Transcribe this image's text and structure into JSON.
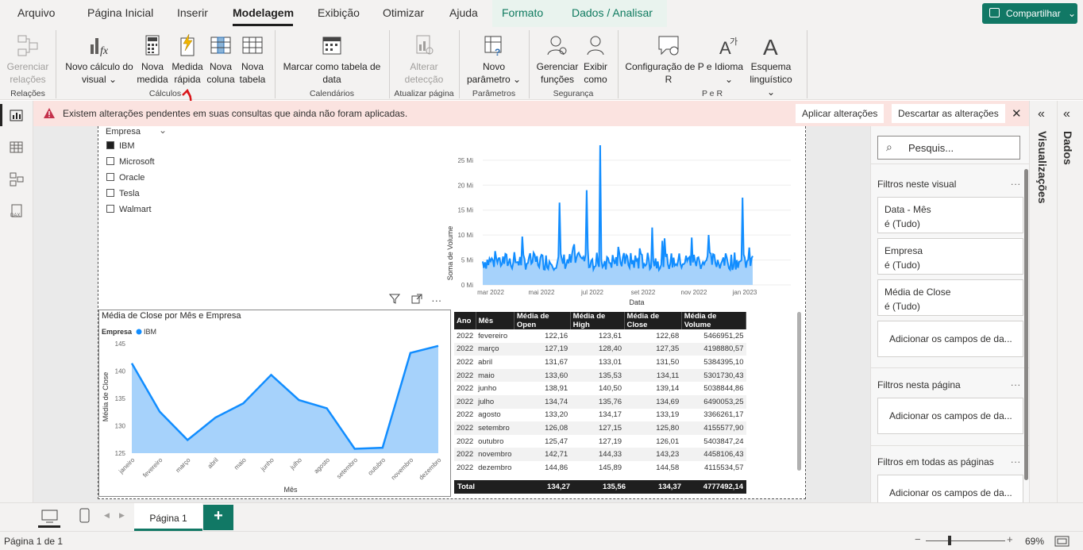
{
  "menu": {
    "items": [
      "Arquivo",
      "Página Inicial",
      "Inserir",
      "Modelagem",
      "Exibição",
      "Otimizar",
      "Ajuda",
      "Formato",
      "Dados / Analisar"
    ],
    "share_label": "Compartilhar"
  },
  "ribbon": {
    "buttons": [
      {
        "label": "Gerenciar relações",
        "icon": "relationships-icon",
        "disabled": true
      },
      {
        "label": "Novo cálculo do visual",
        "icon": "visual-calculation-icon"
      },
      {
        "label": "Nova medida",
        "icon": "calculator-icon"
      },
      {
        "label": "Medida rápida",
        "icon": "quick-measure-icon"
      },
      {
        "label": "Nova coluna",
        "icon": "new-column-icon"
      },
      {
        "label": "Nova tabela",
        "icon": "new-table-icon"
      },
      {
        "label": "Marcar como tabela de data",
        "icon": "calendar-icon"
      },
      {
        "label": "Alterar detecção",
        "icon": "change-detection-icon",
        "disabled": true
      },
      {
        "label": "Novo parâmetro",
        "icon": "parameter-icon"
      },
      {
        "label": "Gerenciar funções",
        "icon": "manage-roles-icon"
      },
      {
        "label": "Exibir como",
        "icon": "view-as-icon"
      },
      {
        "label": "Configuração de P e R",
        "icon": "qa-setup-icon"
      },
      {
        "label": "Idioma",
        "icon": "language-icon"
      },
      {
        "label": "Esquema linguístico",
        "icon": "linguistic-schema-icon"
      }
    ],
    "groups": [
      "Relações",
      "Cálculos",
      "Calendários",
      "Atualizar página",
      "Parâmetros",
      "Segurança",
      "P e R"
    ]
  },
  "warning": {
    "text": "Existem alterações pendentes em suas consultas que ainda não foram aplicadas.",
    "apply_label": "Aplicar alterações",
    "discard_label": "Descartar as alterações"
  },
  "slicer": {
    "title": "Empresa",
    "items": [
      {
        "label": "IBM",
        "checked": true
      },
      {
        "label": "Microsoft",
        "checked": false
      },
      {
        "label": "Oracle",
        "checked": false
      },
      {
        "label": "Tesla",
        "checked": false
      },
      {
        "label": "Walmart",
        "checked": false
      }
    ]
  },
  "volume_chart": {
    "ylabel": "Soma de Volume",
    "xlabel": "Data",
    "yticks": [
      "0 Mi",
      "5 Mi",
      "10 Mi",
      "15 Mi",
      "20 Mi",
      "25 Mi"
    ],
    "xticks": [
      "mar 2022",
      "mai 2022",
      "jul 2022",
      "set 2022",
      "nov 2022",
      "jan 2023"
    ]
  },
  "close_chart": {
    "title": "Média de Close por Mês e Empresa",
    "legend_title": "Empresa",
    "legend_item": "IBM",
    "ylabel": "Média de Close",
    "xlabel": "Mês",
    "yticks": [
      "125",
      "130",
      "135",
      "140",
      "145"
    ]
  },
  "chart_data": [
    {
      "type": "area",
      "title": "",
      "xlabel": "Data",
      "ylabel": "Soma de Volume",
      "ylim": [
        0,
        28000000
      ],
      "x": [
        "mar 2022",
        "mai 2022",
        "jul 2022",
        "set 2022",
        "nov 2022",
        "jan 2023"
      ],
      "series": [
        {
          "values": [
            4500000,
            4000000,
            5000000,
            5500000,
            4200000,
            5300000
          ]
        }
      ],
      "notes_peak": 28000000
    },
    {
      "type": "area",
      "title": "Média de Close por Mês e Empresa",
      "xlabel": "Mês",
      "ylabel": "Média de Close",
      "ylim": [
        125,
        145
      ],
      "categories": [
        "janeiro",
        "fevereiro",
        "março",
        "abril",
        "maio",
        "junho",
        "julho",
        "agosto",
        "setembro",
        "outubro",
        "novembro",
        "dezembro"
      ],
      "series": [
        {
          "name": "IBM",
          "values": [
            141.4,
            132.6,
            127.4,
            131.5,
            134.1,
            139.3,
            134.7,
            133.2,
            125.8,
            126.0,
            143.3,
            144.6
          ]
        }
      ],
      "legend": "top-left"
    }
  ],
  "table": {
    "headers": [
      "Ano",
      "Mês",
      "Média de Open",
      "Média de High",
      "Média de Close",
      "Média de Volume"
    ],
    "rows": [
      [
        "2022",
        "fevereiro",
        "122,16",
        "123,61",
        "122,68",
        "5466951,25"
      ],
      [
        "2022",
        "março",
        "127,19",
        "128,40",
        "127,35",
        "4198880,57"
      ],
      [
        "2022",
        "abril",
        "131,67",
        "133,01",
        "131,50",
        "5384395,10"
      ],
      [
        "2022",
        "maio",
        "133,60",
        "135,53",
        "134,11",
        "5301730,43"
      ],
      [
        "2022",
        "junho",
        "138,91",
        "140,50",
        "139,14",
        "5038844,86"
      ],
      [
        "2022",
        "julho",
        "134,74",
        "135,76",
        "134,69",
        "6490053,25"
      ],
      [
        "2022",
        "agosto",
        "133,20",
        "134,17",
        "133,19",
        "3366261,17"
      ],
      [
        "2022",
        "setembro",
        "126,08",
        "127,15",
        "125,80",
        "4155577,90"
      ],
      [
        "2022",
        "outubro",
        "125,47",
        "127,19",
        "126,01",
        "5403847,24"
      ],
      [
        "2022",
        "novembro",
        "142,71",
        "144,33",
        "143,23",
        "4458106,43"
      ],
      [
        "2022",
        "dezembro",
        "144,86",
        "145,89",
        "144,58",
        "4115534,57"
      ]
    ],
    "total": [
      "Total",
      "134,27",
      "135,56",
      "134,37",
      "4777492,14"
    ]
  },
  "filters": {
    "search_placeholder": "Pesquis...",
    "visual_header": "Filtros neste visual",
    "visual_cards": [
      {
        "name": "Data - Mês",
        "state": "é (Tudo)"
      },
      {
        "name": "Empresa",
        "state": "é (Tudo)"
      },
      {
        "name": "Média de Close",
        "state": "é (Tudo)"
      }
    ],
    "add_fields": "Adicionar os campos de da...",
    "page_header": "Filtros nesta página",
    "all_pages_header": "Filtros em todas as páginas",
    "more": "..."
  },
  "side_panels": {
    "visualizations": "Visualizações",
    "data": "Dados"
  },
  "tabs": {
    "page_label": "Página 1",
    "add": "+"
  },
  "status": {
    "page_info": "Página 1 de 1",
    "zoom": "69%"
  }
}
